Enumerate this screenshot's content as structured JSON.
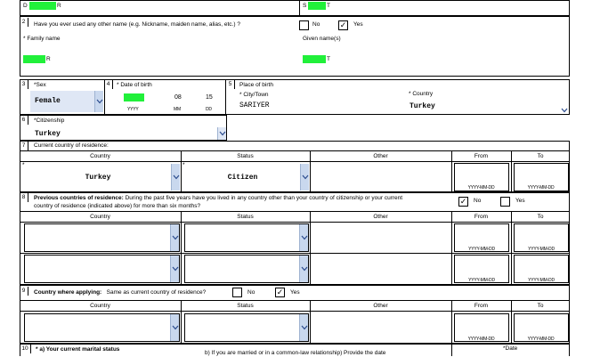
{
  "row1": {
    "family_redacted": "D",
    "family_suffix": "R",
    "given_redacted": "S",
    "given_suffix": "T"
  },
  "q2": {
    "number": "2",
    "question": "Have you ever used any other name (e.g. Nickname, maiden name, alias, etc.) ?",
    "no_label": "No",
    "yes_label": "Yes",
    "yes_checked": "✓",
    "family_label": "* Family name",
    "given_label": "Given name(s)",
    "family_prefix": "",
    "family_suffix": "R",
    "given_suffix": "T"
  },
  "q3": {
    "number": "3",
    "label": "*Sex",
    "value": "Female"
  },
  "q4": {
    "number": "4",
    "label": "* Date of birth",
    "mm": "08",
    "dd": "15",
    "yyyy_ph": "YYYY",
    "mm_ph": "MM",
    "dd_ph": "DD"
  },
  "q5": {
    "number": "5",
    "label": "Place of birth",
    "city_label": "* City/Town",
    "city_value": "SARIYER",
    "country_label": "* Country",
    "country_value": "Turkey"
  },
  "q6": {
    "number": "6",
    "label": "*Citizenship",
    "value": "Turkey"
  },
  "q7": {
    "number": "7",
    "label": "Current country of residence:",
    "headers": [
      "Country",
      "Status",
      "Other",
      "From",
      "To"
    ],
    "country": "Turkey",
    "status": "Citizen",
    "date_ph": "YYYY-MM-DD"
  },
  "q8": {
    "number": "8",
    "label_bold": "Previous countries of residence:",
    "text_line1": "During the past five years have you lived in any country other than your country of citizenship or your current",
    "text_line2": "country of residence (indicated above) for more than six months?",
    "no_label": "No",
    "yes_label": "Yes",
    "no_checked": "✓",
    "headers": [
      "Country",
      "Status",
      "Other",
      "From",
      "To"
    ],
    "date_ph": "YYYY-MM-DD"
  },
  "q9": {
    "number": "9",
    "label_bold": "Country where applying:",
    "question": "Same as current country of residence?",
    "no_label": "No",
    "yes_label": "Yes",
    "yes_checked": "✓",
    "headers": [
      "Country",
      "Status",
      "Other",
      "From",
      "To"
    ],
    "date_ph": "YYYY-MM-DD"
  },
  "q10": {
    "number": "10",
    "label_a": "* a) Your current marital status",
    "label_b": "b) If you are married or in a common-law relationship) Provide the date",
    "date_label": "*Date"
  },
  "colors": {
    "redact": "#21f03a",
    "chevron_bg": "#c9d8ee"
  }
}
